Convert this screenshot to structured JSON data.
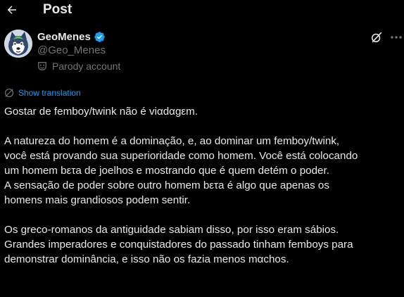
{
  "header": {
    "back_icon": "arrow-left-icon",
    "title": "Post"
  },
  "author": {
    "display_name": "GeoMenes",
    "verified_icon": "verified-badge-icon",
    "verified_color": "#1d9bf0",
    "handle": "@Geo_Menes",
    "label_icon": "theater-mask-icon",
    "label": "Parody account"
  },
  "actions": {
    "grok_icon": "grok-icon",
    "more_icon": "more-dots-icon"
  },
  "translate": {
    "icon": "globe-icon",
    "label": "Show translation",
    "color": "#1d9bf0"
  },
  "post": {
    "paragraphs": [
      "Gostar de femboy/twink não é viαdαgεm.",
      "A natureza do homem é a dominação, e, ao dominar um femboy/twink,\nvocê está provando sua superioridade como homem. Você está colocando\num homem bετa de joelhos e mostrando que é quem detém o poder.\nA sensação de poder sobre outro homem bετa é algo que apenas os\nhomens mais grandiosos podem sentir.",
      "Os greco-romanos da antiguidade sabiam disso, por isso eram sábios.\nGrandes imperadores e conquistadores do passado tinham femboys para\ndemonstrar dominância, e isso não os fazia menos mαchos."
    ]
  },
  "colors": {
    "background": "#000000",
    "text_primary": "#e7e9ea",
    "text_secondary": "#71767b",
    "accent": "#1d9bf0"
  }
}
